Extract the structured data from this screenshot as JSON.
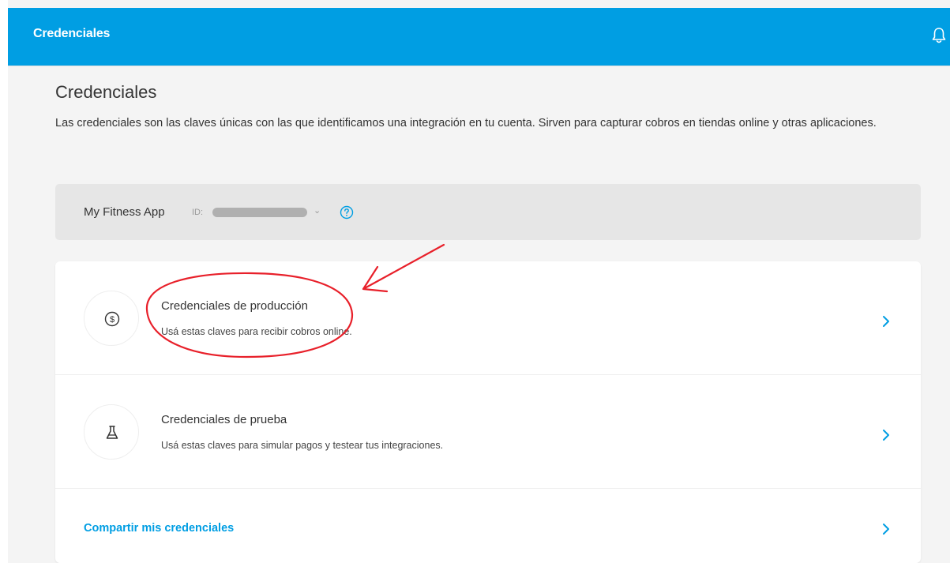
{
  "topbar": {
    "title": "Credenciales",
    "bell_icon": "bell-icon"
  },
  "page": {
    "title": "Credenciales",
    "description": "Las credenciales son las claves únicas con las que identificamos una integración en tu cuenta. Sirven para capturar cobros en tiendas online y otras aplicaciones."
  },
  "app_selector": {
    "name": "My Fitness App",
    "id_label": "ID:",
    "chevron": "⌄",
    "help_icon": "question-circle-icon"
  },
  "credentials": {
    "production": {
      "title": "Credenciales de producción",
      "subtitle": "Usá estas claves para recibir cobros online.",
      "icon": "dollar-coin-icon"
    },
    "test": {
      "title": "Credenciales de prueba",
      "subtitle": "Usá estas claves para simular pagos y testear tus integraciones.",
      "icon": "flask-icon"
    },
    "share": {
      "label": "Compartir mis credenciales"
    }
  },
  "colors": {
    "brand": "#009ee3",
    "annotation": "#e8202a",
    "background": "#f4f4f4"
  }
}
